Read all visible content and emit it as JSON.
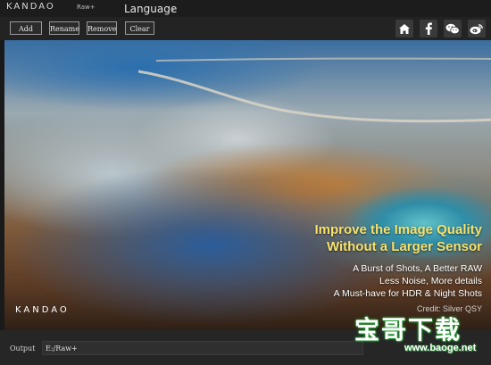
{
  "titlebar": {
    "brand": "KANDAO",
    "brand_suffix": "Raw+",
    "language_menu": "Language"
  },
  "toolbar": {
    "add_label": "Add",
    "rename_label": "Rename",
    "remove_label": "Remove",
    "clear_label": "Clear",
    "icons": [
      "home-icon",
      "facebook-icon",
      "wechat-icon",
      "weibo-icon"
    ]
  },
  "preview": {
    "headline_line1": "Improve the Image Quality",
    "headline_line2": "Without a Larger Sensor",
    "sub1": "A Burst of Shots, A Better RAW",
    "sub2": "Less Noise, More details",
    "sub3": "A Must-have for HDR & Night Shots",
    "credit": "Credit: Silver QSY",
    "logo": "KANDAO",
    "headline_color": "#f7e16a"
  },
  "output": {
    "label": "Output",
    "path": "E:/Raw+"
  },
  "watermark": {
    "main": "宝哥下载",
    "url": "www.baoge.net"
  }
}
